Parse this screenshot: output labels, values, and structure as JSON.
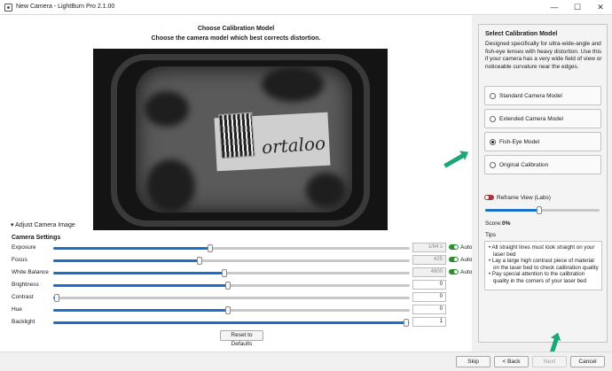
{
  "window": {
    "title": "New Camera - LightBurn Pro 2.1.00",
    "minimize_glyph": "—",
    "maximize_glyph": "☐",
    "close_glyph": "✕",
    "icon": "camera-app-icon"
  },
  "main": {
    "title": "Choose Calibration Model",
    "subtitle": "Choose the camera model which best corrects distortion.",
    "adjust_label": "Adjust Camera Image",
    "settings_title": "Camera Settings",
    "reset_label": "Reset to Defaults"
  },
  "settings": [
    {
      "label": "Exposure",
      "value": "1/64 s",
      "level": 0.44,
      "disabled": true,
      "auto": true,
      "auto_label": "Auto"
    },
    {
      "label": "Focus",
      "value": "425",
      "level": 0.41,
      "disabled": true,
      "auto": true,
      "auto_label": "Auto"
    },
    {
      "label": "White Balance",
      "value": "4600",
      "level": 0.48,
      "disabled": true,
      "auto": true,
      "auto_label": "Auto"
    },
    {
      "label": "Brightness",
      "value": "0",
      "level": 0.49,
      "disabled": false
    },
    {
      "label": "Contrast",
      "value": "0",
      "level": 0.01,
      "disabled": false
    },
    {
      "label": "Hue",
      "value": "0",
      "level": 0.49,
      "disabled": false
    },
    {
      "label": "Backlight",
      "value": "1",
      "level": 0.99,
      "disabled": false
    }
  ],
  "sidebar": {
    "title": "Select Calibration Model",
    "description": "Designed specifically for ultra-wide-angle and fish-eye lenses with heavy distortion. Use this if your camera has a very wide field of view or noticeable curvature near the edges.",
    "models": [
      {
        "label": "Standard Camera Model",
        "selected": false
      },
      {
        "label": "Extended Camera Model",
        "selected": false
      },
      {
        "label": "Fish-Eye Model",
        "selected": true
      },
      {
        "label": "Original Calibration",
        "selected": false
      }
    ],
    "reframe_label": "Reframe View (Labs)",
    "reframe_enabled": false,
    "reframe_level": 0.47,
    "score_label": "Score:",
    "score_value": "0%",
    "tips_label": "Tips",
    "tips": [
      "• All straight lines must look straight on your laser bed",
      "• Lay a large high contrast piece of material on the laser bed to check calibration quality",
      "• Pay special attention to the calibration quality in the corners of your laser bed"
    ]
  },
  "footer": {
    "skip": "Skip",
    "back": "< Back",
    "next": "Next",
    "cancel": "Cancel"
  },
  "colors": {
    "accent": "#1c70c8",
    "toggle_on": "#2c8f2c",
    "toggle_off": "#a33a3a",
    "annotation_arrow": "#1aa87a"
  }
}
